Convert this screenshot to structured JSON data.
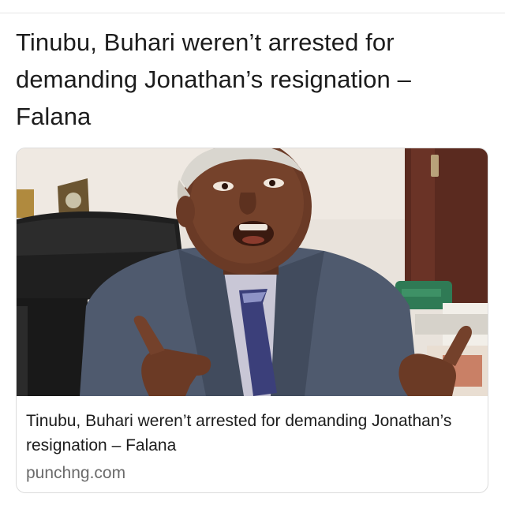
{
  "post": {
    "headline": "Tinubu, Buhari weren’t arrested for demanding Jonathan’s resignation – Falana"
  },
  "link_card": {
    "title": "Tinubu, Buhari weren’t arrested for demanding Jonathan’s resignation – Falana",
    "domain": "punchng.com",
    "image_subject": "man-in-suit-gesturing-photo"
  },
  "colors": {
    "text_primary": "#1c1c1c",
    "text_secondary": "#6b6b6b",
    "card_border": "#dcdcdc"
  }
}
